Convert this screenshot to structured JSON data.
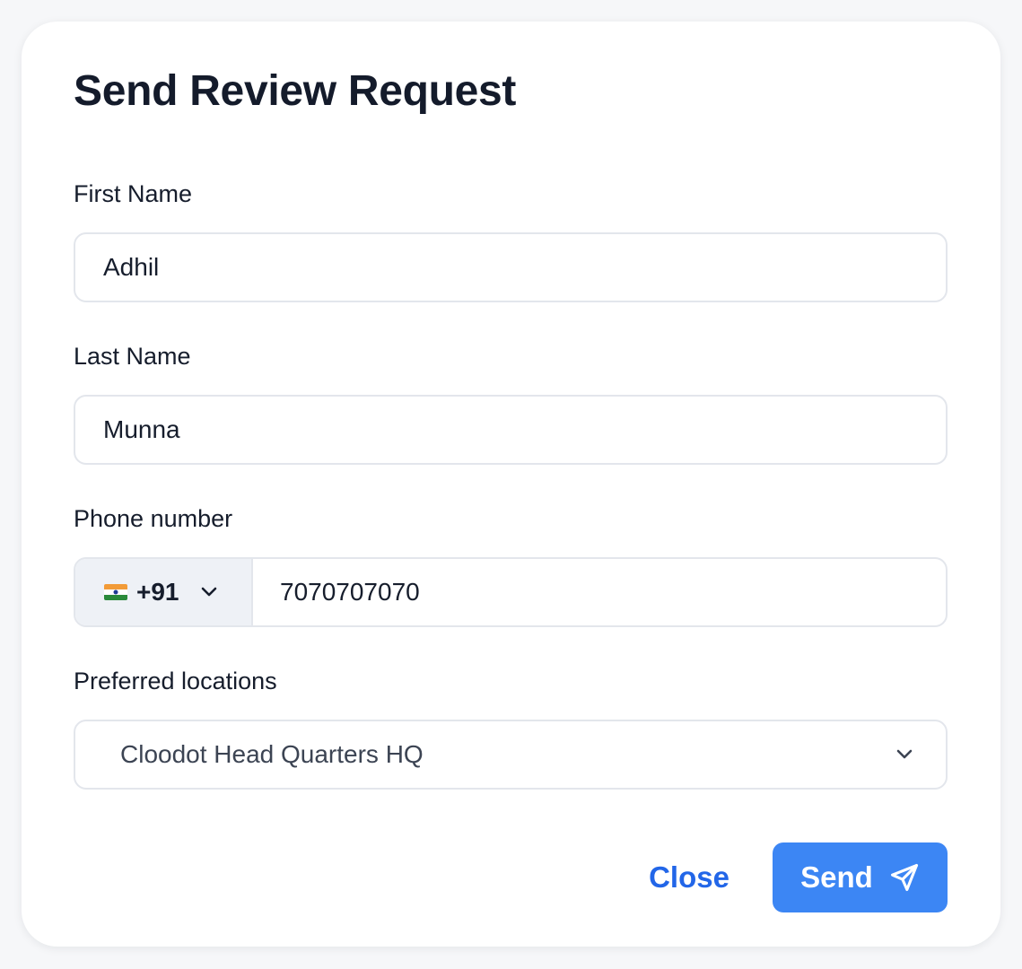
{
  "dialog": {
    "title": "Send Review Request"
  },
  "form": {
    "first_name": {
      "label": "First Name",
      "value": "Adhil"
    },
    "last_name": {
      "label": "Last Name",
      "value": "Munna"
    },
    "phone": {
      "label": "Phone number",
      "country_flag": "india-flag-icon",
      "dial_code": "+91",
      "value": "7070707070"
    },
    "location": {
      "label": "Preferred locations",
      "selected": "Cloodot Head Quarters HQ"
    }
  },
  "actions": {
    "close_label": "Close",
    "send_label": "Send",
    "send_icon": "paper-plane-icon"
  },
  "colors": {
    "primary": "#3c86f4",
    "link": "#2266e8",
    "text": "#161d2c",
    "border": "#e3e6ec"
  }
}
